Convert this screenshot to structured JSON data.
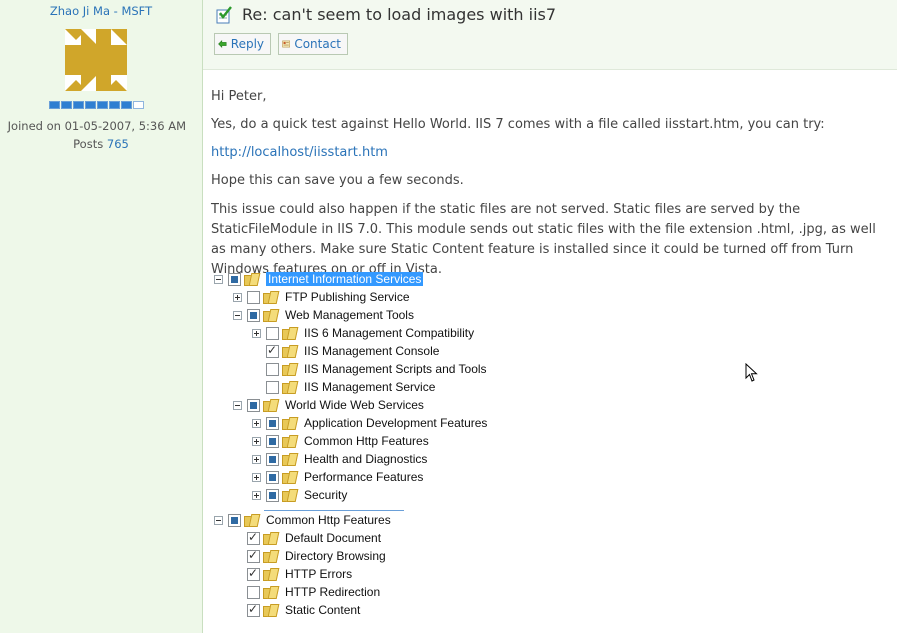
{
  "author": {
    "name": "Zhao Ji Ma - MSFT",
    "joined": "Joined on 01-05-2007, 5:36 AM",
    "posts_label": "Posts",
    "posts_count": "765",
    "rank_filled": 7,
    "rank_total": 8
  },
  "post": {
    "title": "Re: can't seem to load images with iis7",
    "reply_label": "Reply",
    "contact_label": "Contact"
  },
  "body": {
    "greeting": "Hi Peter,",
    "p1": "Yes, do a quick test against Hello World. IIS 7 comes with a file called iisstart.htm, you can try:",
    "link": "http://localhost/iisstart.htm",
    "p2": "Hope this can save you a few seconds.",
    "p3": "This issue could also happen if the static files are not served. Static files are served by the StaticFileModule in IIS 7.0. This module sends out static files with the file extension .html, .jpg, as well as many others. Make sure Static Content feature is installed since it could be turned off from Turn Windows features on or off in Vista."
  },
  "tree1": [
    {
      "label": "Internet Information Services"
    },
    {
      "label": "FTP Publishing Service"
    },
    {
      "label": "Web Management Tools"
    },
    {
      "label": "IIS 6 Management Compatibility"
    },
    {
      "label": "IIS Management Console"
    },
    {
      "label": "IIS Management Scripts and Tools"
    },
    {
      "label": "IIS Management Service"
    },
    {
      "label": "World Wide Web Services"
    },
    {
      "label": "Application Development Features"
    },
    {
      "label": "Common Http Features"
    },
    {
      "label": "Health and Diagnostics"
    },
    {
      "label": "Performance Features"
    },
    {
      "label": "Security"
    }
  ],
  "tree2": [
    {
      "label": "Common Http Features"
    },
    {
      "label": "Default Document"
    },
    {
      "label": "Directory Browsing"
    },
    {
      "label": "HTTP Errors"
    },
    {
      "label": "HTTP Redirection"
    },
    {
      "label": "Static Content"
    }
  ],
  "colors": {
    "author_bg": "#eef8e9",
    "link": "#2a73b8",
    "selection": "#3399ff",
    "avatar": "#d0a62a"
  }
}
